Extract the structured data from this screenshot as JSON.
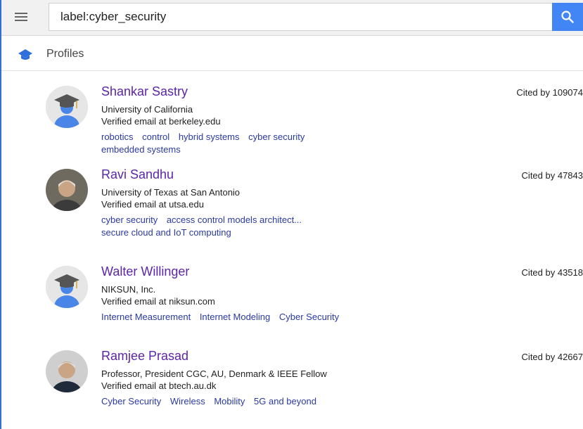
{
  "search": {
    "value": "label:cyber_security"
  },
  "section": {
    "title": "Profiles"
  },
  "profiles": [
    {
      "name": "Shankar Sastry",
      "affiliation": "University of California",
      "email": "Verified email at berkeley.edu",
      "cited": "Cited by 109074",
      "avatar": "default-scholar-avatar",
      "tags": [
        "robotics",
        "control",
        "hybrid systems",
        "cyber security",
        "embedded systems"
      ]
    },
    {
      "name": "Ravi Sandhu",
      "affiliation": "University of Texas at San Antonio",
      "email": "Verified email at utsa.edu",
      "cited": "Cited by 47843",
      "avatar": "photo",
      "tags": [
        "cyber security",
        "access control models architect...",
        "secure cloud and IoT computing"
      ]
    },
    {
      "name": "Walter Willinger",
      "affiliation": "NIKSUN, Inc.",
      "email": "Verified email at niksun.com",
      "cited": "Cited by 43518",
      "avatar": "default-scholar-avatar",
      "tags": [
        "Internet Measurement",
        "Internet Modeling",
        "Cyber Security"
      ]
    },
    {
      "name": "Ramjee Prasad",
      "affiliation": "Professor, President CGC, AU, Denmark & IEEE Fellow",
      "email": "Verified email at btech.au.dk",
      "cited": "Cited by 42667",
      "avatar": "photo",
      "tags": [
        "Cyber Security",
        "Wireless",
        "Mobility",
        "5G and beyond"
      ]
    }
  ],
  "colors": {
    "accent": "#4285f4",
    "name_link": "#5b25a8",
    "tag_link": "#2a3aa0"
  },
  "icons": [
    "menu-icon",
    "search-icon",
    "graduation-cap-icon"
  ]
}
